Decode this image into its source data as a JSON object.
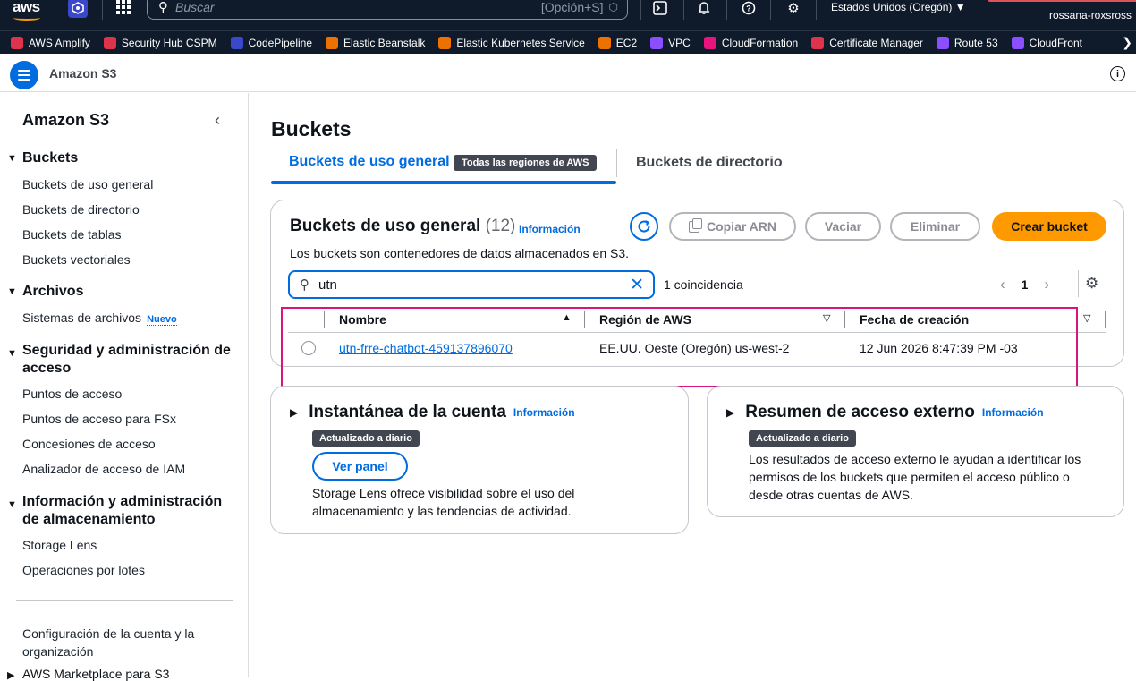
{
  "topnav": {
    "search_placeholder": "Buscar",
    "search_shortcut": "[Opción+S]",
    "region": "Estados Unidos (Oregón)",
    "user": "rossana-roxsross"
  },
  "favorites": [
    {
      "label": "AWS Amplify",
      "color": "#dd344c"
    },
    {
      "label": "Security Hub CSPM",
      "color": "#dd344c"
    },
    {
      "label": "CodePipeline",
      "color": "#3b48cc"
    },
    {
      "label": "Elastic Beanstalk",
      "color": "#ed7100"
    },
    {
      "label": "Elastic Kubernetes Service",
      "color": "#ed7100"
    },
    {
      "label": "EC2",
      "color": "#ed7100"
    },
    {
      "label": "VPC",
      "color": "#8c4fff"
    },
    {
      "label": "CloudFormation",
      "color": "#e7157b"
    },
    {
      "label": "Certificate Manager",
      "color": "#dd344c"
    },
    {
      "label": "Route 53",
      "color": "#8c4fff"
    },
    {
      "label": "CloudFront",
      "color": "#8c4fff"
    }
  ],
  "service": {
    "name": "Amazon S3"
  },
  "sidebar": {
    "title": "Amazon S3",
    "sections": {
      "buckets": "Buckets",
      "archivos": "Archivos",
      "seguridad_1": "Seguridad y administración de",
      "seguridad_2": "acceso",
      "info_1": "Información y administración",
      "info_2": "de almacenamiento"
    },
    "links": {
      "uso_general": "Buckets de uso general",
      "directorio": "Buckets de directorio",
      "tablas": "Buckets de tablas",
      "vectoriales": "Buckets vectoriales",
      "sistemas": "Sistemas de archivos",
      "nuevo": "Nuevo",
      "puntos": "Puntos de acceso",
      "puntos_fsx": "Puntos de acceso para FSx",
      "concesiones": "Concesiones de acceso",
      "analizador": "Analizador de acceso de IAM",
      "storage_lens": "Storage Lens",
      "operaciones": "Operaciones por lotes",
      "config_1": "Configuración de la cuenta y la",
      "config_2": "organización",
      "marketplace": "AWS Marketplace para S3"
    }
  },
  "main": {
    "title": "Buckets",
    "tabs": {
      "active": "Buckets de uso general",
      "badge": "Todas las regiones de AWS",
      "other": "Buckets de directorio"
    },
    "panel": {
      "title": "Buckets de uso general",
      "count": "(12)",
      "info": "Información",
      "description": "Los buckets son contenedores de datos almacenados en S3.",
      "copy_arn": "Copiar ARN",
      "empty": "Vaciar",
      "delete": "Eliminar",
      "create": "Crear bucket",
      "filter_value": "utn",
      "matches": "1 coincidencia",
      "page": "1",
      "columns": {
        "name": "Nombre",
        "region": "Región de AWS",
        "created": "Fecha de creación"
      },
      "rows": [
        {
          "name": "utn-frre-chatbot-459137896070",
          "region": "EE.UU. Oeste (Oregón) us-west-2",
          "created": "12 Jun 2026 8:47:39 PM -03"
        }
      ]
    },
    "snapshot": {
      "title": "Instantánea de la cuenta",
      "info": "Información",
      "badge": "Actualizado a diario",
      "button": "Ver panel",
      "text_1": "Storage Lens ofrece visibilidad sobre el uso del",
      "text_2": "almacenamiento y las tendencias de actividad."
    },
    "external": {
      "title": "Resumen de acceso externo",
      "info": "Información",
      "badge": "Actualizado a diario",
      "text_1": "Los resultados de acceso externo le ayudan a identificar los",
      "text_2": "permisos de los buckets que permiten el acceso público o",
      "text_3": "desde otras cuentas de AWS."
    }
  }
}
